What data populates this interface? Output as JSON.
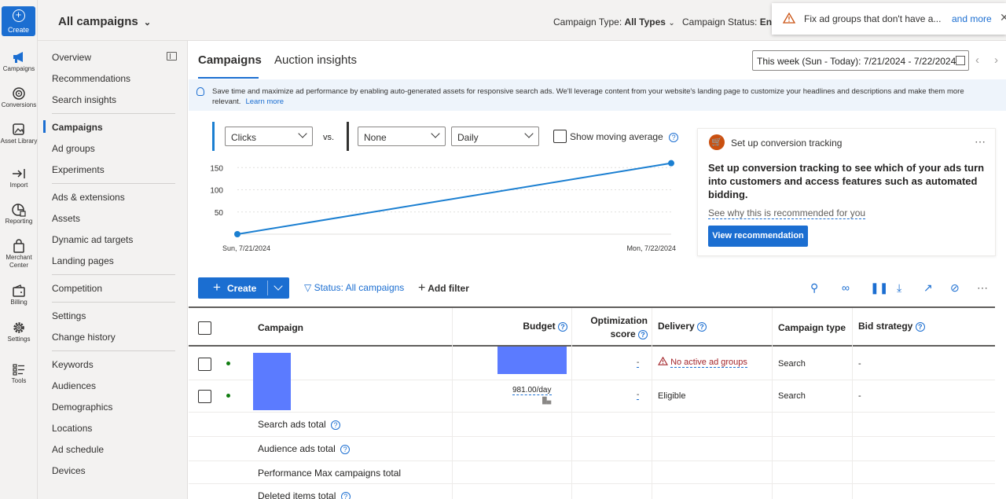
{
  "rail": {
    "create": "Create",
    "items": [
      "Campaigns",
      "Conversions",
      "Asset Library",
      "Import",
      "Reporting",
      "Merchant Center",
      "Billing",
      "Settings",
      "Tools"
    ]
  },
  "topbar": {
    "title": "All campaigns",
    "campaign_type_label": "Campaign Type:",
    "campaign_type_value": "All Types",
    "campaign_status_label": "Campaign Status:",
    "campaign_status_value": "Ena",
    "notification": {
      "message": "Fix ad groups that don't have a...",
      "more": "and more"
    }
  },
  "sidenav": {
    "groups": [
      [
        "Overview",
        "Recommendations",
        "Search insights"
      ],
      [
        "Campaigns",
        "Ad groups",
        "Experiments"
      ],
      [
        "Ads & extensions",
        "Assets",
        "Dynamic ad targets",
        "Landing pages"
      ],
      [
        "Competition"
      ],
      [
        "Settings",
        "Change history"
      ],
      [
        "Keywords",
        "Audiences",
        "Demographics",
        "Locations",
        "Ad schedule",
        "Devices"
      ]
    ],
    "active": "Campaigns"
  },
  "tabs": [
    "Campaigns",
    "Auction insights"
  ],
  "date_range": "This week (Sun - Today): 7/21/2024 - 7/22/2024",
  "banner": {
    "text": "Save time and maximize ad performance by enabling auto-generated assets for responsive search ads. We'll leverage content from your website's landing page to customize your headlines and descriptions and make them more relevant.",
    "link": "Learn more"
  },
  "chart_controls": {
    "metric1": "Clicks",
    "vs": "vs.",
    "metric2": "None",
    "granularity": "Daily",
    "moving_average": "Show moving average",
    "colors": {
      "series1": "#1b7fd1",
      "series2": "#323130"
    }
  },
  "chart_data": {
    "type": "line",
    "x": [
      "Sun, 7/21/2024",
      "Mon, 7/22/2024"
    ],
    "series": [
      {
        "values": [
          0,
          160
        ]
      }
    ],
    "yticks": [
      50,
      100,
      150
    ],
    "ylim": [
      0,
      170
    ],
    "grid": true
  },
  "recommendation": {
    "title": "Set up conversion tracking",
    "body": "Set up conversion tracking to see which of your ads turn into customers and access features such as automated bidding.",
    "why": "See why this is recommended for you",
    "button": "View recommendation"
  },
  "toolbar": {
    "create": "Create",
    "status_filter": "Status: All campaigns",
    "add_filter": "Add filter"
  },
  "table": {
    "headers": {
      "campaign": "Campaign",
      "budget": "Budget",
      "optimization_line1": "Optimization",
      "optimization_line2": "score",
      "delivery": "Delivery",
      "campaign_type": "Campaign type",
      "bid_strategy": "Bid strategy"
    },
    "rows": [
      {
        "budget": "",
        "score": "-",
        "delivery": "No active ad groups",
        "type": "Search",
        "bid": "-"
      },
      {
        "budget": "981.00/day",
        "score": "-",
        "delivery": "Eligible",
        "type": "Search",
        "bid": "-"
      }
    ],
    "totals": [
      "Search ads total",
      "Audience ads total",
      "Performance Max campaigns total",
      "Deleted items total"
    ]
  }
}
